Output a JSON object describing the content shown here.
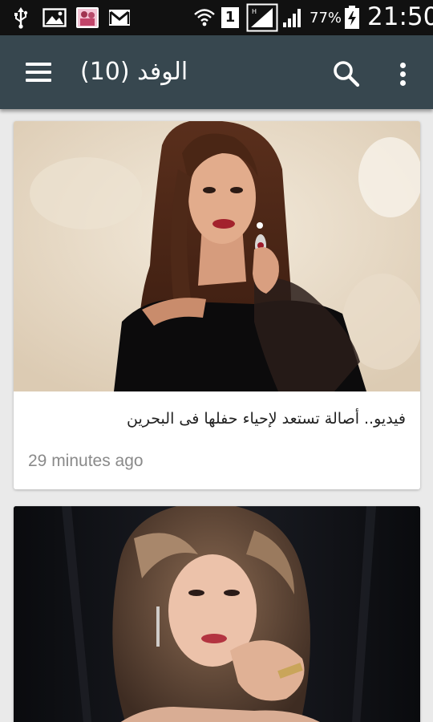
{
  "status_bar": {
    "sim_slot": "1",
    "battery_percent": "77%",
    "time": "21:50"
  },
  "app_bar": {
    "title": "الوفد (10)",
    "icons": [
      "menu-icon",
      "search-icon",
      "more-vert-icon"
    ]
  },
  "feed": {
    "items": [
      {
        "headline": "فيديو.. أصالة تستعد لإحياء حفلها فى البحرين",
        "time": "29 minutes ago"
      }
    ]
  },
  "colors": {
    "status_bar": "#111111",
    "app_bar": "#37474f",
    "background": "#eaeaea",
    "card": "#ffffff",
    "timestamp": "#8a8a8a"
  }
}
